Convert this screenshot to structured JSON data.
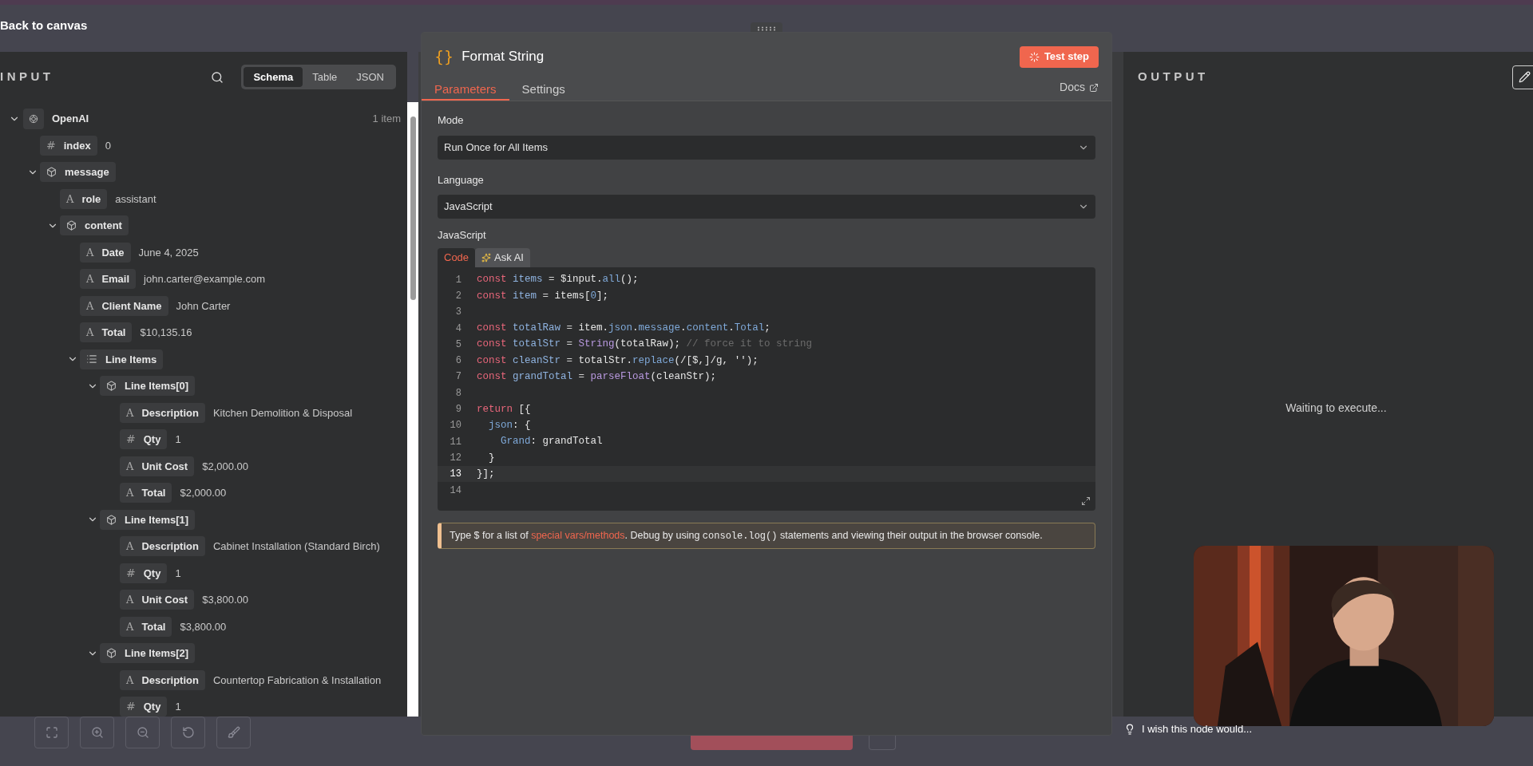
{
  "top_bar": {
    "back_link": "Back to canvas"
  },
  "input_panel": {
    "title": "INPUT",
    "views": [
      {
        "label": "Schema",
        "selected": true
      },
      {
        "label": "Table",
        "selected": false
      },
      {
        "label": "JSON",
        "selected": false
      }
    ],
    "tree": [
      {
        "kind": "node",
        "label": "OpenAI",
        "count": "1 item",
        "expanded": true,
        "children": [
          {
            "kind": "number",
            "glyph": "#",
            "label": "index",
            "value": "0"
          },
          {
            "kind": "object",
            "label": "message",
            "expanded": true,
            "children": [
              {
                "kind": "string",
                "glyph": "A",
                "label": "role",
                "value": "assistant"
              },
              {
                "kind": "object",
                "label": "content",
                "expanded": true,
                "children": [
                  {
                    "kind": "string",
                    "glyph": "A",
                    "label": "Date",
                    "value": "June 4, 2025"
                  },
                  {
                    "kind": "string",
                    "glyph": "A",
                    "label": "Email",
                    "value": "john.carter@example.com"
                  },
                  {
                    "kind": "string",
                    "glyph": "A",
                    "label": "Client Name",
                    "value": "John Carter"
                  },
                  {
                    "kind": "string",
                    "glyph": "A",
                    "label": "Total",
                    "value": "$10,135.16"
                  },
                  {
                    "kind": "array",
                    "label": "Line Items",
                    "expanded": true,
                    "children": [
                      {
                        "kind": "object",
                        "label": "Line Items[0]",
                        "expanded": true,
                        "children": [
                          {
                            "kind": "string",
                            "glyph": "A",
                            "label": "Description",
                            "value": "Kitchen Demolition & Disposal"
                          },
                          {
                            "kind": "number",
                            "glyph": "#",
                            "label": "Qty",
                            "value": "1"
                          },
                          {
                            "kind": "string",
                            "glyph": "A",
                            "label": "Unit Cost",
                            "value": "$2,000.00"
                          },
                          {
                            "kind": "string",
                            "glyph": "A",
                            "label": "Total",
                            "value": "$2,000.00"
                          }
                        ]
                      },
                      {
                        "kind": "object",
                        "label": "Line Items[1]",
                        "expanded": true,
                        "children": [
                          {
                            "kind": "string",
                            "glyph": "A",
                            "label": "Description",
                            "value": "Cabinet Installation (Standard Birch)"
                          },
                          {
                            "kind": "number",
                            "glyph": "#",
                            "label": "Qty",
                            "value": "1"
                          },
                          {
                            "kind": "string",
                            "glyph": "A",
                            "label": "Unit Cost",
                            "value": "$3,800.00"
                          },
                          {
                            "kind": "string",
                            "glyph": "A",
                            "label": "Total",
                            "value": "$3,800.00"
                          }
                        ]
                      },
                      {
                        "kind": "object",
                        "label": "Line Items[2]",
                        "expanded": true,
                        "children": [
                          {
                            "kind": "string",
                            "glyph": "A",
                            "label": "Description",
                            "value": "Countertop Fabrication & Installation"
                          },
                          {
                            "kind": "number",
                            "glyph": "#",
                            "label": "Qty",
                            "value": "1"
                          }
                        ]
                      }
                    ]
                  }
                ]
              }
            ]
          }
        ]
      }
    ]
  },
  "node_panel": {
    "icon_glyph": "{}",
    "title": "Format String",
    "test_button": "Test step",
    "tabs": [
      {
        "label": "Parameters",
        "selected": true
      },
      {
        "label": "Settings",
        "selected": false
      }
    ],
    "docs_link": "Docs",
    "fields": [
      {
        "label": "Mode",
        "value": "Run Once for All Items"
      },
      {
        "label": "Language",
        "value": "JavaScript"
      }
    ],
    "code_label": "JavaScript",
    "code_tabs": [
      {
        "kind": "code",
        "label": "Code",
        "selected": true
      },
      {
        "kind": "ai",
        "label": "Ask AI",
        "selected": false
      }
    ],
    "code_lines": [
      {
        "number": "1",
        "active": false,
        "tokens": [
          {
            "kind": "kw",
            "text": "const "
          },
          {
            "kind": "def",
            "text": "items"
          },
          {
            "kind": "op",
            "text": " = "
          },
          {
            "kind": "plain",
            "text": "$input."
          },
          {
            "kind": "prop",
            "text": "all"
          },
          {
            "kind": "plain",
            "text": "();"
          }
        ]
      },
      {
        "number": "2",
        "active": false,
        "tokens": [
          {
            "kind": "kw",
            "text": "const "
          },
          {
            "kind": "def",
            "text": "item"
          },
          {
            "kind": "op",
            "text": " = "
          },
          {
            "kind": "plain",
            "text": "items["
          },
          {
            "kind": "num",
            "text": "0"
          },
          {
            "kind": "plain",
            "text": "];"
          }
        ]
      },
      {
        "number": "3",
        "active": false
      },
      {
        "number": "4",
        "active": false,
        "tokens": [
          {
            "kind": "kw",
            "text": "const "
          },
          {
            "kind": "def",
            "text": "totalRaw"
          },
          {
            "kind": "op",
            "text": " = "
          },
          {
            "kind": "plain",
            "text": "item."
          },
          {
            "kind": "prop",
            "text": "json"
          },
          {
            "kind": "plain",
            "text": "."
          },
          {
            "kind": "prop",
            "text": "message"
          },
          {
            "kind": "plain",
            "text": "."
          },
          {
            "kind": "prop",
            "text": "content"
          },
          {
            "kind": "plain",
            "text": "."
          },
          {
            "kind": "prop",
            "text": "Total"
          },
          {
            "kind": "plain",
            "text": ";"
          }
        ]
      },
      {
        "number": "5",
        "active": false,
        "tokens": [
          {
            "kind": "kw",
            "text": "const "
          },
          {
            "kind": "def",
            "text": "totalStr"
          },
          {
            "kind": "op",
            "text": " = "
          },
          {
            "kind": "fn",
            "text": "String"
          },
          {
            "kind": "plain",
            "text": "(totalRaw); "
          },
          {
            "kind": "com",
            "text": "// force it to string"
          }
        ]
      },
      {
        "number": "6",
        "active": false,
        "tokens": [
          {
            "kind": "kw",
            "text": "const "
          },
          {
            "kind": "def",
            "text": "cleanStr"
          },
          {
            "kind": "op",
            "text": " = "
          },
          {
            "kind": "plain",
            "text": "totalStr."
          },
          {
            "kind": "prop",
            "text": "replace"
          },
          {
            "kind": "plain",
            "text": "("
          },
          {
            "kind": "str",
            "text": "/[$,]/g"
          },
          {
            "kind": "plain",
            "text": ", "
          },
          {
            "kind": "str",
            "text": "''"
          },
          {
            "kind": "plain",
            "text": ");"
          }
        ]
      },
      {
        "number": "7",
        "active": false,
        "tokens": [
          {
            "kind": "kw",
            "text": "const "
          },
          {
            "kind": "def",
            "text": "grandTotal"
          },
          {
            "kind": "op",
            "text": " = "
          },
          {
            "kind": "fn",
            "text": "parseFloat"
          },
          {
            "kind": "plain",
            "text": "(cleanStr);"
          }
        ]
      },
      {
        "number": "8",
        "active": false
      },
      {
        "number": "9",
        "active": false,
        "tokens": [
          {
            "kind": "kw",
            "text": "return "
          },
          {
            "kind": "plain",
            "text": "[{"
          }
        ]
      },
      {
        "number": "10",
        "active": false,
        "tokens": [
          {
            "kind": "prop",
            "text": "  json"
          },
          {
            "kind": "plain",
            "text": ": {"
          }
        ]
      },
      {
        "number": "11",
        "active": false,
        "tokens": [
          {
            "kind": "prop",
            "text": "    Grand"
          },
          {
            "kind": "plain",
            "text": ": grandTotal"
          }
        ]
      },
      {
        "number": "12",
        "active": false,
        "tokens": [
          {
            "kind": "plain",
            "text": "  }"
          }
        ]
      },
      {
        "number": "13",
        "active": true,
        "tokens": [
          {
            "kind": "plain",
            "text": "}];"
          }
        ]
      },
      {
        "number": "14",
        "active": false
      }
    ],
    "hint": [
      {
        "kind": "text",
        "text": "Type $ for a list of "
      },
      {
        "kind": "link",
        "text": "special vars/methods"
      },
      {
        "kind": "text",
        "text": ". Debug by using "
      },
      {
        "kind": "code",
        "text": "console.log()"
      },
      {
        "kind": "text",
        "text": " statements and viewing their output in the browser console."
      }
    ]
  },
  "output_panel": {
    "title": "OUTPUT",
    "status": "Waiting to execute..."
  },
  "feedback": {
    "text": "I wish this node would..."
  }
}
